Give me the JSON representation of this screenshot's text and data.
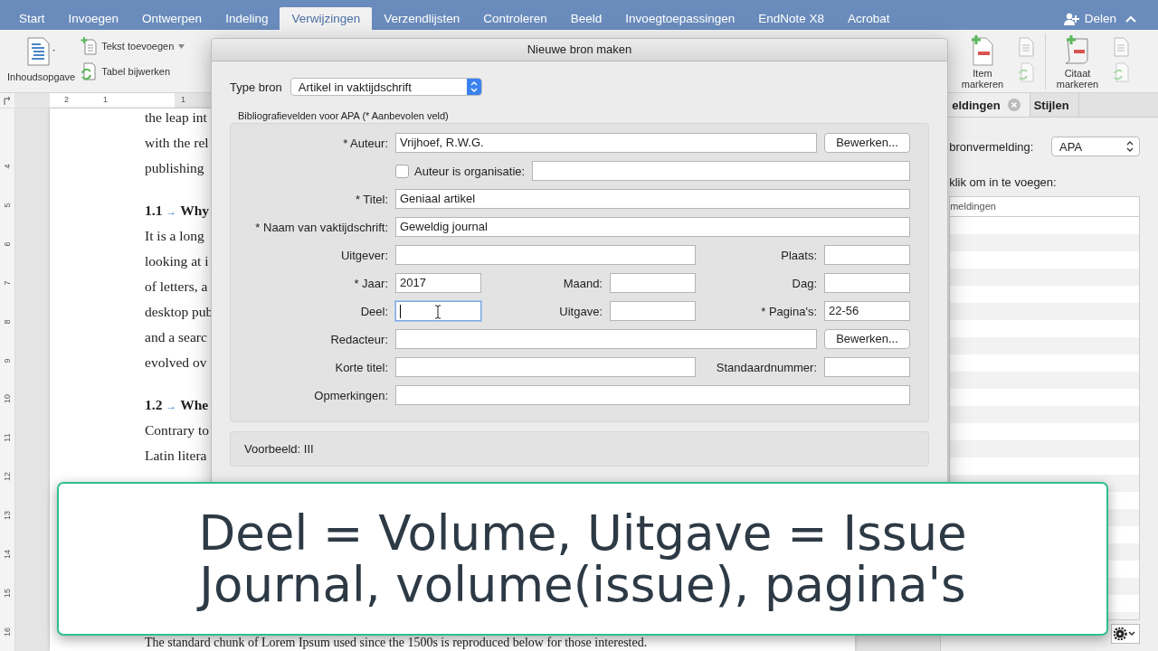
{
  "ribbon_tabs": [
    {
      "label": "Start",
      "selected": false
    },
    {
      "label": "Invoegen",
      "selected": false
    },
    {
      "label": "Ontwerpen",
      "selected": false
    },
    {
      "label": "Indeling",
      "selected": false
    },
    {
      "label": "Verwijzingen",
      "selected": true
    },
    {
      "label": "Verzendlijsten",
      "selected": false
    },
    {
      "label": "Controleren",
      "selected": false
    },
    {
      "label": "Beeld",
      "selected": false
    },
    {
      "label": "Invoegtoepassingen",
      "selected": false
    },
    {
      "label": "EndNote X8",
      "selected": false
    },
    {
      "label": "Acrobat",
      "selected": false
    }
  ],
  "share": {
    "label": "Delen"
  },
  "ribbon": {
    "toc": {
      "label": "Inhoudsopgave"
    },
    "small": [
      {
        "label": "Tekst toevoegen",
        "dropdown": true
      },
      {
        "label": "Tabel bijwerken",
        "dropdown": false
      }
    ],
    "marks": [
      {
        "label": "Item markeren"
      },
      {
        "label": "Citaat markeren"
      }
    ]
  },
  "rulers": {
    "horizontal": [
      "2",
      "1",
      "1"
    ],
    "vertical": [
      "4",
      "5",
      "6",
      "7",
      "8",
      "9",
      "10",
      "11",
      "12",
      "13",
      "14",
      "15",
      "16"
    ]
  },
  "document": {
    "lines": [
      {
        "kind": "text",
        "text": "the leap int"
      },
      {
        "kind": "text",
        "text": "with the rel"
      },
      {
        "kind": "text",
        "text": "publishing"
      },
      {
        "kind": "heading",
        "number": "1.1",
        "marker": "→",
        "text": "Why"
      },
      {
        "kind": "text",
        "text": "It is a long"
      },
      {
        "kind": "text",
        "text": "looking at i"
      },
      {
        "kind": "text",
        "text": "of letters, a"
      },
      {
        "kind": "text",
        "text": "desktop pub"
      },
      {
        "kind": "text",
        "text": "and a searc"
      },
      {
        "kind": "text",
        "text": "evolved ov"
      },
      {
        "kind": "heading",
        "number": "1.2",
        "marker": "→",
        "text": "Whe"
      },
      {
        "kind": "text",
        "text": "Contrary to"
      },
      {
        "kind": "text",
        "text": "Latin litera"
      }
    ],
    "bottom_line": "The standard chunk of Lorem Ipsum used since the 1500s is reproduced below for those interested."
  },
  "dialog": {
    "title": "Nieuwe bron maken",
    "type_label": "Type bron",
    "type_value": "Artikel in vaktijdschrift",
    "section_label": "Bibliografievelden voor APA  (* Aanbevolen veld)",
    "rows": [
      {
        "kind": "wide_button",
        "fields": [
          {
            "label": "* Auteur:",
            "value": "Vrijhoef, R.W.G.",
            "focused": false
          }
        ],
        "button": "Bewerken..."
      },
      {
        "kind": "checkbox",
        "label": "Auteur is organisatie:",
        "checked": false
      },
      {
        "kind": "full",
        "fields": [
          {
            "label": "* Titel:",
            "value": "Geniaal artikel",
            "focused": false
          }
        ]
      },
      {
        "kind": "full",
        "fields": [
          {
            "label": "* Naam van vaktijdschrift:",
            "value": "Geweldig journal",
            "focused": false
          }
        ]
      },
      {
        "kind": "split",
        "fields": [
          {
            "label": "Uitgever:",
            "focused": false
          },
          {
            "label": "Plaats:",
            "focused": false
          }
        ]
      },
      {
        "kind": "triple",
        "fields": [
          {
            "label": "* Jaar:",
            "value": "2017",
            "focused": false
          },
          {
            "label": "Maand:",
            "focused": false
          },
          {
            "label": "Dag:",
            "focused": false
          }
        ]
      },
      {
        "kind": "triple",
        "fields": [
          {
            "label": "Deel:",
            "focused": true
          },
          {
            "label": "Uitgave:",
            "focused": false
          },
          {
            "label": "* Pagina's:",
            "value": "22-56",
            "focused": false
          }
        ]
      },
      {
        "kind": "wide_button",
        "fields": [
          {
            "label": "Redacteur:",
            "focused": false
          }
        ],
        "button": "Bewerken..."
      },
      {
        "kind": "split",
        "fields": [
          {
            "label": "Korte titel:",
            "focused": false
          },
          {
            "label": "Standaardnummer:",
            "focused": false
          }
        ]
      },
      {
        "kind": "full",
        "fields": [
          {
            "label": "Opmerkingen:",
            "focused": false
          }
        ]
      }
    ],
    "preview": "Voorbeeld: III"
  },
  "side_pane": {
    "tabs": [
      {
        "label": "eldingen",
        "selected": true,
        "closable": true
      },
      {
        "label": "Stijlen",
        "selected": false,
        "closable": false
      }
    ],
    "style_label": "bronvermelding:",
    "style_value": "APA",
    "hint": "klik om in te voegen:",
    "list_header": "meldingen"
  },
  "caption": {
    "lines": [
      "Deel = Volume, Uitgave = Issue",
      "Journal, volume(issue), pagina's"
    ]
  }
}
